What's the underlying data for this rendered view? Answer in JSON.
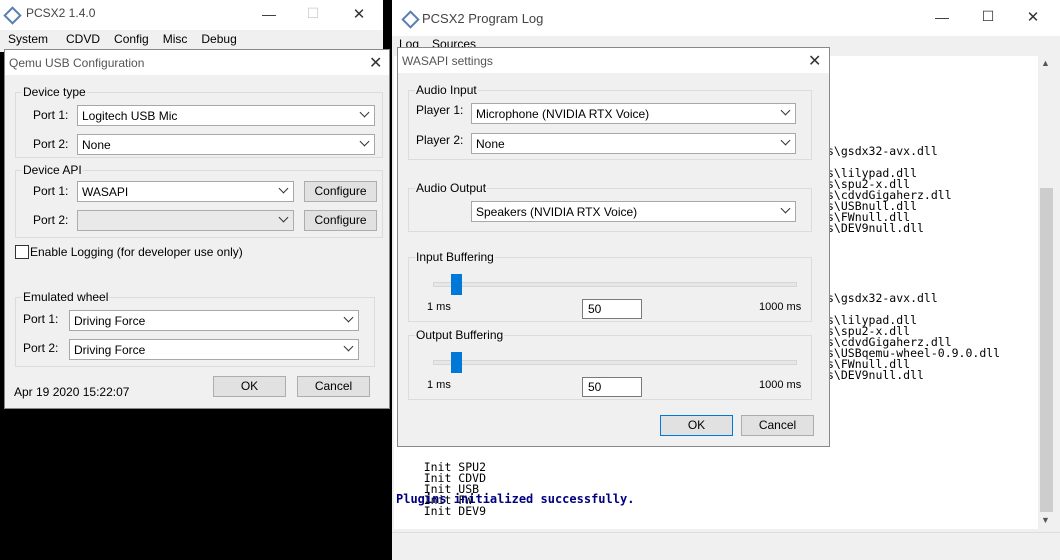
{
  "pcsx2": {
    "title": "PCSX2  1.4.0",
    "menu": [
      "System",
      "CDVD",
      "Config",
      "Misc",
      "Debug"
    ],
    "minimize": "—",
    "maximize": "☐",
    "close": "✕"
  },
  "log": {
    "title": "PCSX2 Program Log",
    "menu": [
      "Log",
      "Sources"
    ],
    "minimize": "—",
    "maximize": "☐",
    "close": "✕",
    "lines_a": [
      "s\\gsdx32-avx.dll",
      "",
      "s\\lilypad.dll",
      "s\\spu2-x.dll",
      "s\\cdvdGigaherz.dll",
      "s\\USBnull.dll",
      "s\\FWnull.dll",
      "s\\DEV9null.dll"
    ],
    "lines_b": [
      "s\\gsdx32-avx.dll",
      "",
      "s\\lilypad.dll",
      "s\\spu2-x.dll",
      "s\\cdvdGigaherz.dll",
      "s\\USBqemu-wheel-0.9.0.dll",
      "s\\FWnull.dll",
      "s\\DEV9null.dll"
    ],
    "lines_c": [
      "    Init SPU2",
      "    Init CDVD",
      "    Init USB",
      "    Init FW",
      "    Init DEV9"
    ],
    "success": "Plugins initialized successfully."
  },
  "qemu": {
    "title": "Qemu USB Configuration",
    "close": "✕",
    "device_type": {
      "title": "Device type",
      "port1_label": "Port 1:",
      "port1_value": "Logitech USB Mic",
      "port2_label": "Port 2:",
      "port2_value": "None"
    },
    "device_api": {
      "title": "Device API",
      "port1_label": "Port 1:",
      "port1_value": "WASAPI",
      "port2_label": "Port 2:",
      "port2_value": "",
      "configure": "Configure"
    },
    "enable_logging": "Enable Logging (for developer use only)",
    "wheel": {
      "title": "Emulated wheel",
      "port1_label": "Port 1:",
      "port1_value": "Driving Force",
      "port2_label": "Port 2:",
      "port2_value": "Driving Force"
    },
    "date": "Apr 19 2020 15:22:07",
    "ok": "OK",
    "cancel": "Cancel"
  },
  "wasapi": {
    "title": "WASAPI settings",
    "close": "✕",
    "audio_input": {
      "title": "Audio Input",
      "player1_label": "Player 1:",
      "player1_value": "Microphone (NVIDIA RTX Voice)",
      "player2_label": "Player 2:",
      "player2_value": "None"
    },
    "audio_output": {
      "title": "Audio Output",
      "value": "Speakers (NVIDIA RTX Voice)"
    },
    "input_buffering": {
      "title": "Input Buffering",
      "min": "1 ms",
      "max": "1000 ms",
      "value": "50"
    },
    "output_buffering": {
      "title": "Output Buffering",
      "min": "1 ms",
      "max": "1000 ms",
      "value": "50"
    },
    "ok": "OK",
    "cancel": "Cancel"
  },
  "colors": {
    "accent": "#0078d7",
    "log_blue": "#000080"
  }
}
